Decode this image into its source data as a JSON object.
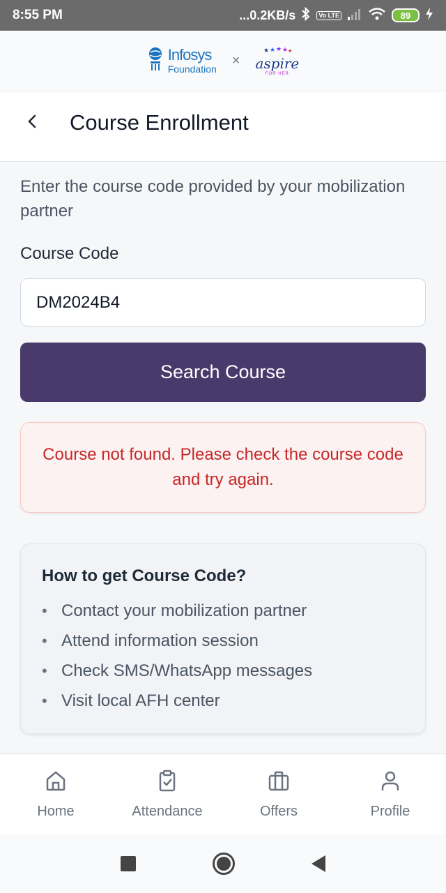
{
  "status_bar": {
    "time": "8:55 PM",
    "network_speed": "...0.2KB/s",
    "volte_label": "Vo LTE",
    "battery": "89"
  },
  "header": {
    "infosys_name": "Infosys",
    "infosys_sub": "Foundation",
    "separator": "×",
    "aspire_name": "aspire",
    "aspire_sub": "FOR HER"
  },
  "title_bar": {
    "back_icon": "chevron-left-icon",
    "title": "Course Enrollment"
  },
  "form": {
    "intro": "Enter the course code provided by your mobilization partner",
    "code_label": "Course Code",
    "code_value": "DM2024B4",
    "search_label": "Search Course"
  },
  "error": {
    "message": "Course not found. Please check the course code and try again."
  },
  "help": {
    "title": "How to get Course Code?",
    "items": [
      "Contact your mobilization partner",
      "Attend information session",
      "Check SMS/WhatsApp messages",
      "Visit local AFH center"
    ]
  },
  "bottom_nav": {
    "items": [
      {
        "label": "Home",
        "icon": "home-icon"
      },
      {
        "label": "Attendance",
        "icon": "clipboard-icon"
      },
      {
        "label": "Offers",
        "icon": "briefcase-icon"
      },
      {
        "label": "Profile",
        "icon": "user-icon"
      }
    ]
  },
  "colors": {
    "primary_button": "#4a3a6b",
    "error_text": "#c62828",
    "error_bg": "#fdf2f2"
  }
}
